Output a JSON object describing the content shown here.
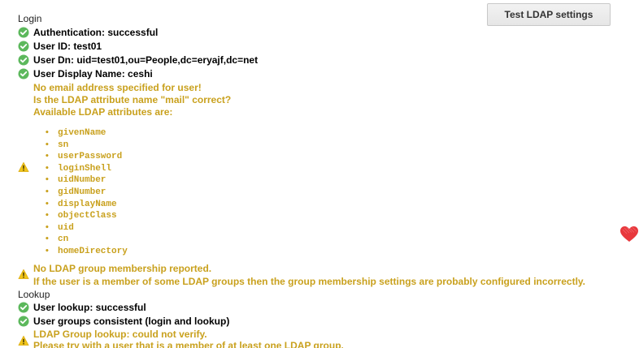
{
  "toolbar": {
    "test_button_label": "Test LDAP settings"
  },
  "login": {
    "title": "Login",
    "authentication": "Authentication: successful",
    "user_id": "User ID: test01",
    "user_dn": "User Dn: uid=test01,ou=People,dc=eryajf,dc=net",
    "display_name": "User Display Name: ceshi",
    "email_warning": {
      "line1": "No email address specified for user!",
      "line2": "Is the LDAP attribute name \"mail\" correct?",
      "line3": "Available LDAP attributes are:",
      "attributes": [
        "givenName",
        "sn",
        "userPassword",
        "loginShell",
        "uidNumber",
        "gidNumber",
        "displayName",
        "objectClass",
        "uid",
        "cn",
        "homeDirectory"
      ]
    },
    "group_warning": {
      "line1": "No LDAP group membership reported.",
      "line2": "If the user is a member of some LDAP groups then the group membership settings are probably configured incorrectly."
    }
  },
  "lookup": {
    "title": "Lookup",
    "user_lookup": "User lookup: successful",
    "groups_consistent": "User groups consistent (login and lookup)",
    "group_lookup_warning": {
      "line1": "LDAP Group lookup: could not verify.",
      "line2": "Please try with a user that is a member of at least one LDAP group."
    }
  },
  "colors": {
    "success": "#5cb85c",
    "warning": "#c9a11e",
    "warning_icon": "#f0c419",
    "heart": "#e8383d"
  },
  "icons": {
    "success": "check-circle-icon",
    "warning": "warning-triangle-icon",
    "decoration": "heart-icon"
  }
}
